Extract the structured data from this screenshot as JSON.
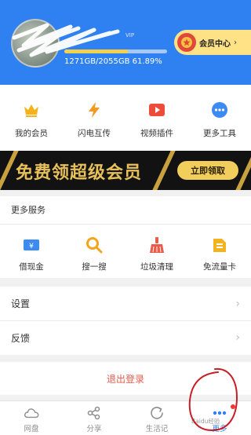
{
  "header": {
    "quota_text": "1271GB/2055GB 61.89%",
    "quota_fraction": 0.6189,
    "vip_tag": "VIP",
    "vip_center_label": "会员中心",
    "vip_center_chevron": "›"
  },
  "tools": [
    {
      "label": "我的会员",
      "icon": "crown-icon"
    },
    {
      "label": "闪电互传",
      "icon": "lightning-icon"
    },
    {
      "label": "视频插件",
      "icon": "video-play-icon"
    },
    {
      "label": "更多工具",
      "icon": "more-dots-icon"
    }
  ],
  "banner": {
    "title": "免费领超级会员",
    "button": "立即领取"
  },
  "services": {
    "heading": "更多服务",
    "items": [
      {
        "label": "借现金",
        "icon": "cash-icon"
      },
      {
        "label": "搜一搜",
        "icon": "search-icon"
      },
      {
        "label": "垃圾清理",
        "icon": "broom-icon"
      },
      {
        "label": "免流量卡",
        "icon": "sim-card-icon"
      }
    ]
  },
  "settings": {
    "items": [
      {
        "label": "设置",
        "chevron": "›"
      },
      {
        "label": "反馈",
        "chevron": "›"
      }
    ]
  },
  "logout": {
    "label": "退出登录"
  },
  "nav": {
    "tabs": [
      {
        "label": "网盘",
        "icon": "cloud-icon",
        "active": false
      },
      {
        "label": "分享",
        "icon": "share-icon",
        "active": false
      },
      {
        "label": "生活记",
        "icon": "refresh-circle-icon",
        "active": false
      },
      {
        "label": "更多",
        "icon": "more-dots-icon",
        "active": true
      }
    ]
  },
  "watermark": "Baidu经验",
  "colors": {
    "header_blue": "#2f80f0",
    "gold": "#f1cd5b",
    "logout_red": "#e55c4a",
    "active_tab": "#2f80f0"
  }
}
